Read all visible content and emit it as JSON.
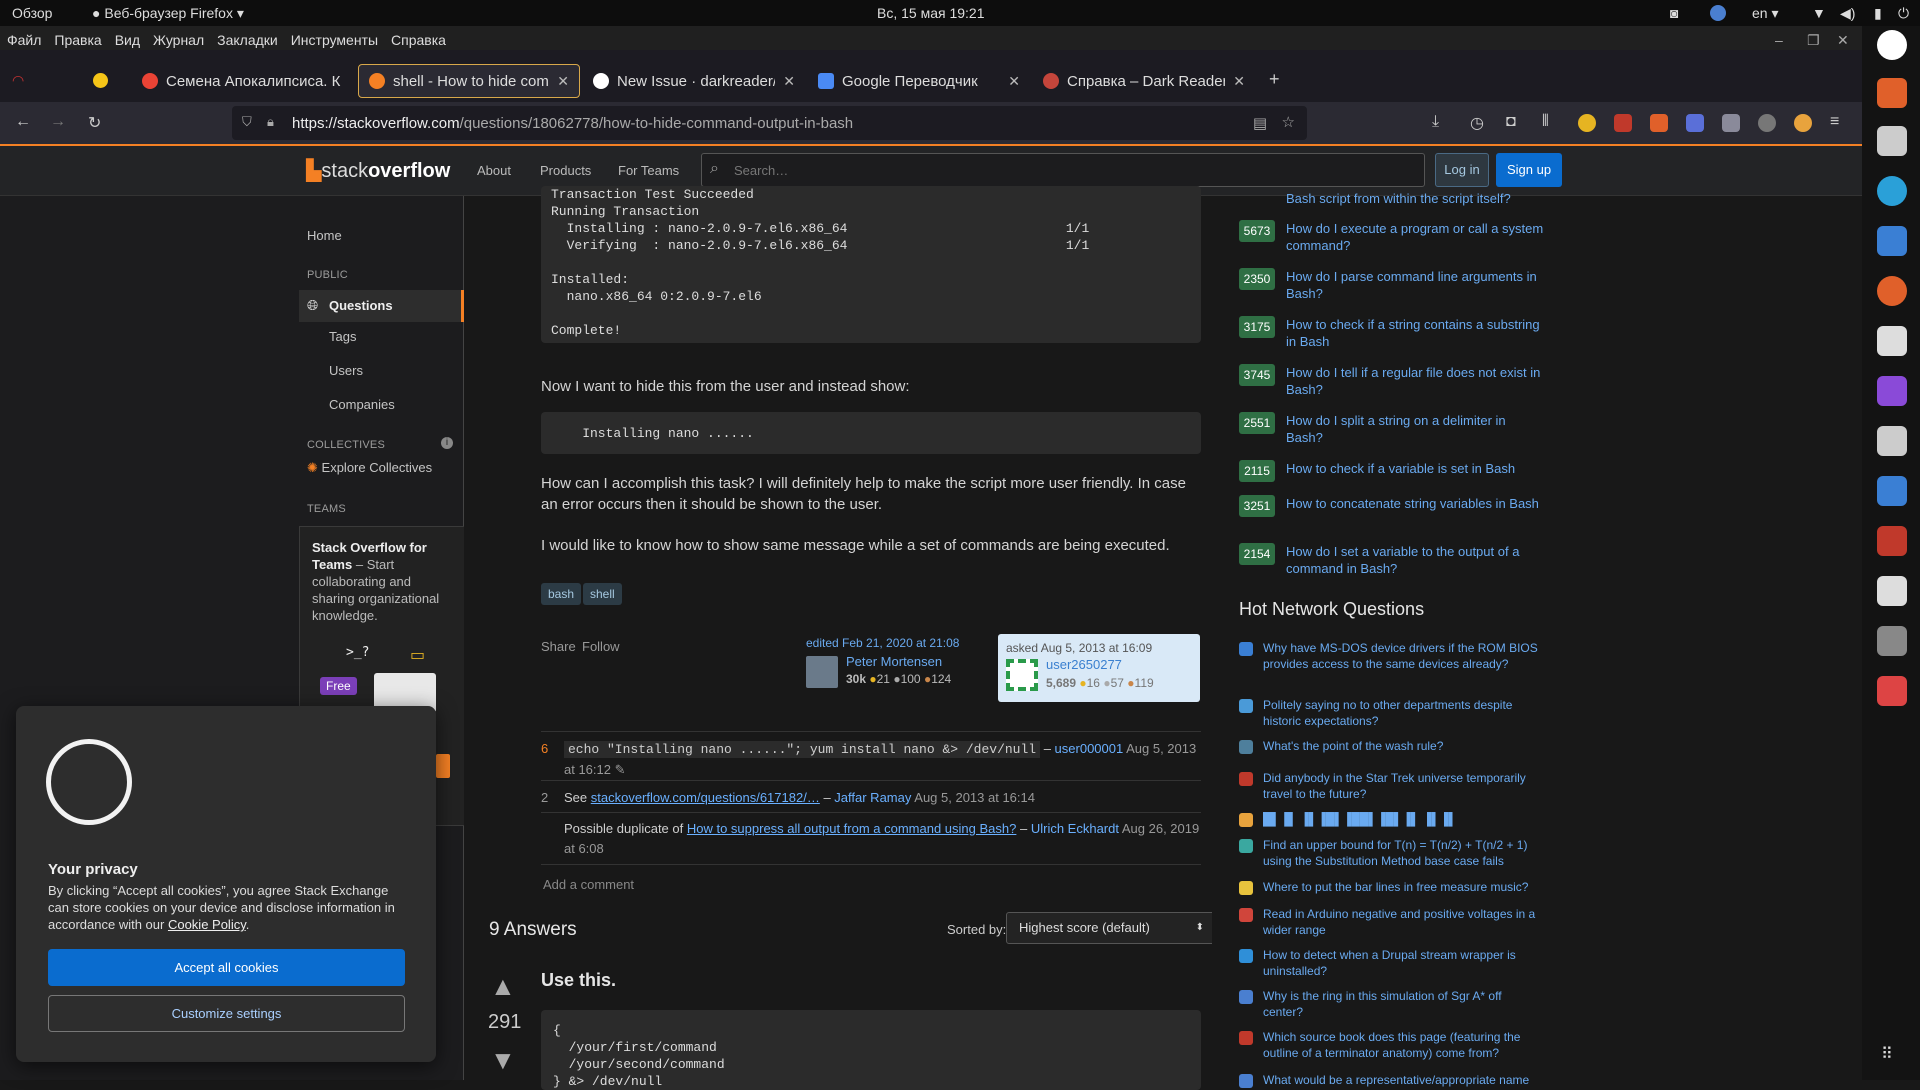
{
  "system_bar": {
    "overview": "Обзор",
    "app": "Веб-браузер Firefox ▾",
    "clock": "Вс, 15 мая  19:21",
    "lang": "en ▾"
  },
  "menu": [
    "Файл",
    "Правка",
    "Вид",
    "Журнал",
    "Закладки",
    "Инструменты",
    "Справка"
  ],
  "tabs": [
    {
      "label": "Семена Апокалипсиса. К",
      "icon_color": "#ea4335"
    },
    {
      "label": "shell - How to hide comm",
      "icon_color": "#f48024"
    },
    {
      "label": "New Issue · darkreader/d",
      "icon_color": "#ffffff"
    },
    {
      "label": "Google Переводчик",
      "icon_color": "#4a8af4"
    },
    {
      "label": "Справка – Dark Reader",
      "icon_color": "#c4453b"
    }
  ],
  "url": {
    "host": "https://stackoverflow.com",
    "path": "/questions/18062778/how-to-hide-command-output-in-bash"
  },
  "so_header": {
    "logo_a": "stack",
    "logo_b": "overflow",
    "nav": [
      "About",
      "Products",
      "For Teams"
    ],
    "search_placeholder": "Search…",
    "login": "Log in",
    "signup": "Sign up"
  },
  "sidebar": {
    "home": "Home",
    "public": "PUBLIC",
    "questions": "Questions",
    "tags": "Tags",
    "users": "Users",
    "companies": "Companies",
    "collectives": "COLLECTIVES",
    "explore": "Explore Collectives",
    "teams": "TEAMS",
    "teams_title": "Stack Overflow for Teams",
    "teams_desc": " – Start collaborating and sharing organizational knowledge.",
    "prompt": ">_?",
    "free": "Free"
  },
  "question": {
    "code1": "Transaction Test Succeeded\nRunning Transaction\n  Installing : nano-2.0.9-7.el6.x86_64                            1/1\n  Verifying  : nano-2.0.9-7.el6.x86_64                            1/1\n\nInstalled:\n  nano.x86_64 0:2.0.9-7.el6\n\nComplete!",
    "p1": "Now I want to hide this from the user and instead show:",
    "code2": "    Installing nano ......",
    "p2": "How can I accomplish this task? I will definitely help to make the script more user friendly. In case an error occurs then it should be shown to the user.",
    "p3": "I would like to know how to show same message while a set of commands are being executed.",
    "tags": [
      "bash",
      "shell"
    ],
    "share": "Share",
    "follow": "Follow",
    "edited": "edited Feb 21, 2020 at 21:08",
    "editor": "Peter Mortensen",
    "editor_rep": "30k",
    "editor_badges": [
      "21",
      "100",
      "124"
    ],
    "asked": "asked Aug 5, 2013 at 16:09",
    "asker": "user2650277",
    "asker_rep": "5,689",
    "asker_badges": [
      "16",
      "57",
      "119"
    ]
  },
  "comments": [
    {
      "score": "6",
      "code": "echo \"Installing nano ......\"; yum install nano &> /dev/null",
      "dash": " – ",
      "user": "user000001",
      "time": " Aug 5, 2013 at 16:12"
    },
    {
      "score": "2",
      "pre": "See ",
      "link": "stackoverflow.com/questions/617182/…",
      "dash": " – ",
      "user": "Jaffar Ramay",
      "time": " Aug 5, 2013 at 16:14"
    },
    {
      "score": "",
      "pre": "Possible duplicate of ",
      "link": "How to suppress all output from a command using Bash?",
      "dash": " – ",
      "user": "Ulrich Eckhardt",
      "time": " Aug 26, 2019 at 6:08"
    }
  ],
  "add_comment": "Add a comment",
  "answers": {
    "count": "9 Answers",
    "sorted_by": "Sorted by:",
    "sort_value": "Highest score (default)",
    "vote": "291",
    "title": "Use this.",
    "code": "{\n  /your/first/command\n  /your/second/command\n} &> /dev/null"
  },
  "related": [
    {
      "score": "",
      "title": "Bash script from within the script itself?"
    },
    {
      "score": "5673",
      "title": "How do I execute a program or call a system command?"
    },
    {
      "score": "2350",
      "title": "How do I parse command line arguments in Bash?"
    },
    {
      "score": "3175",
      "title": "How to check if a string contains a substring in Bash"
    },
    {
      "score": "3745",
      "title": "How do I tell if a regular file does not exist in Bash?"
    },
    {
      "score": "2551",
      "title": "How do I split a string on a delimiter in Bash?"
    },
    {
      "score": "2115",
      "title": "How to check if a variable is set in Bash"
    },
    {
      "score": "3251",
      "title": "How to concatenate string variables in Bash"
    },
    {
      "score": "2154",
      "title": "How do I set a variable to the output of a command in Bash?"
    }
  ],
  "hnq": {
    "title": "Hot Network Questions",
    "items": [
      {
        "title": "Why have MS-DOS device drivers if the ROM BIOS provides access to the same devices already?",
        "color": "#3a7fd4"
      },
      {
        "title": "Politely saying no to other departments despite historic expectations?",
        "color": "#4a9ad8"
      },
      {
        "title": "What's the point of the wash rule?",
        "color": "#4e7f9c"
      },
      {
        "title": "Did anybody in the Star Trek universe temporarily travel to the future?",
        "color": "#c0392b"
      },
      {
        "title": "█▌▐▌ ▐▌▐█▌▐██▌▐█▌▐▌ ▐▌▐▌",
        "color": "#e8a33d"
      },
      {
        "title": "Find an upper bound for T(n) = T(n/2) + T(n/2 + 1) using the Substitution Method base case fails",
        "color": "#3aa8a0"
      },
      {
        "title": "Where to put the bar lines in free measure music?",
        "color": "#e8c33d"
      },
      {
        "title": "Read in Arduino negative and positive voltages in a wider range",
        "color": "#d0453b"
      },
      {
        "title": "How to detect when a Drupal stream wrapper is uninstalled?",
        "color": "#2f8fd8"
      },
      {
        "title": "Why is the ring in this simulation of Sgr A* off center?",
        "color": "#4a7fd0"
      },
      {
        "title": "Which source book does this page (featuring the outline of a terminator anatomy) come from?",
        "color": "#c0392b"
      },
      {
        "title": "What would be a representative/appropriate name",
        "color": "#4a7fd0"
      }
    ]
  },
  "cookie": {
    "title": "Your privacy",
    "text": "By clicking “Accept all cookies”, you agree Stack Exchange can store cookies on your device and disclose information in accordance with our ",
    "policy": "Cookie Policy",
    "end": ".",
    "accept": "Accept all cookies",
    "customize": "Customize settings"
  }
}
